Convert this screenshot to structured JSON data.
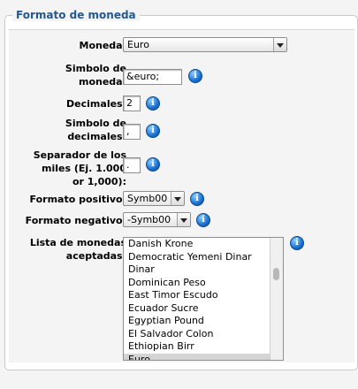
{
  "section": {
    "title": "Formato de moneda"
  },
  "fields": {
    "moneda": {
      "label": "Moneda:",
      "value": "Euro"
    },
    "simbolo_moneda": {
      "label": "Simbolo de moneda:",
      "value": "&euro;"
    },
    "decimales": {
      "label": "Decimales:",
      "value": "2"
    },
    "simbolo_decimales": {
      "label": "Simbolo de decimales:",
      "value": ","
    },
    "separador_miles": {
      "label": "Separador de los miles (Ej. 1.000 or 1,000):",
      "value": "."
    },
    "formato_positivo": {
      "label": "Formato positivo:",
      "value": "Symb00"
    },
    "formato_negativo": {
      "label": "Formato negativo:",
      "value": "-Symb00"
    },
    "lista_monedas": {
      "label": "Lista de monedas aceptadas:",
      "items": [
        "Danish Krone",
        "Democratic Yemeni Dinar",
        "Dinar",
        "Dominican Peso",
        "East Timor Escudo",
        "Ecuador Sucre",
        "Egyptian Pound",
        "El Salvador Colon",
        "Ethiopian Birr",
        "Euro"
      ],
      "selected": "Euro"
    }
  },
  "info_icon_glyph": "i",
  "colors": {
    "legend": "#1f5a94",
    "info_icon": "#1a6fd0"
  }
}
